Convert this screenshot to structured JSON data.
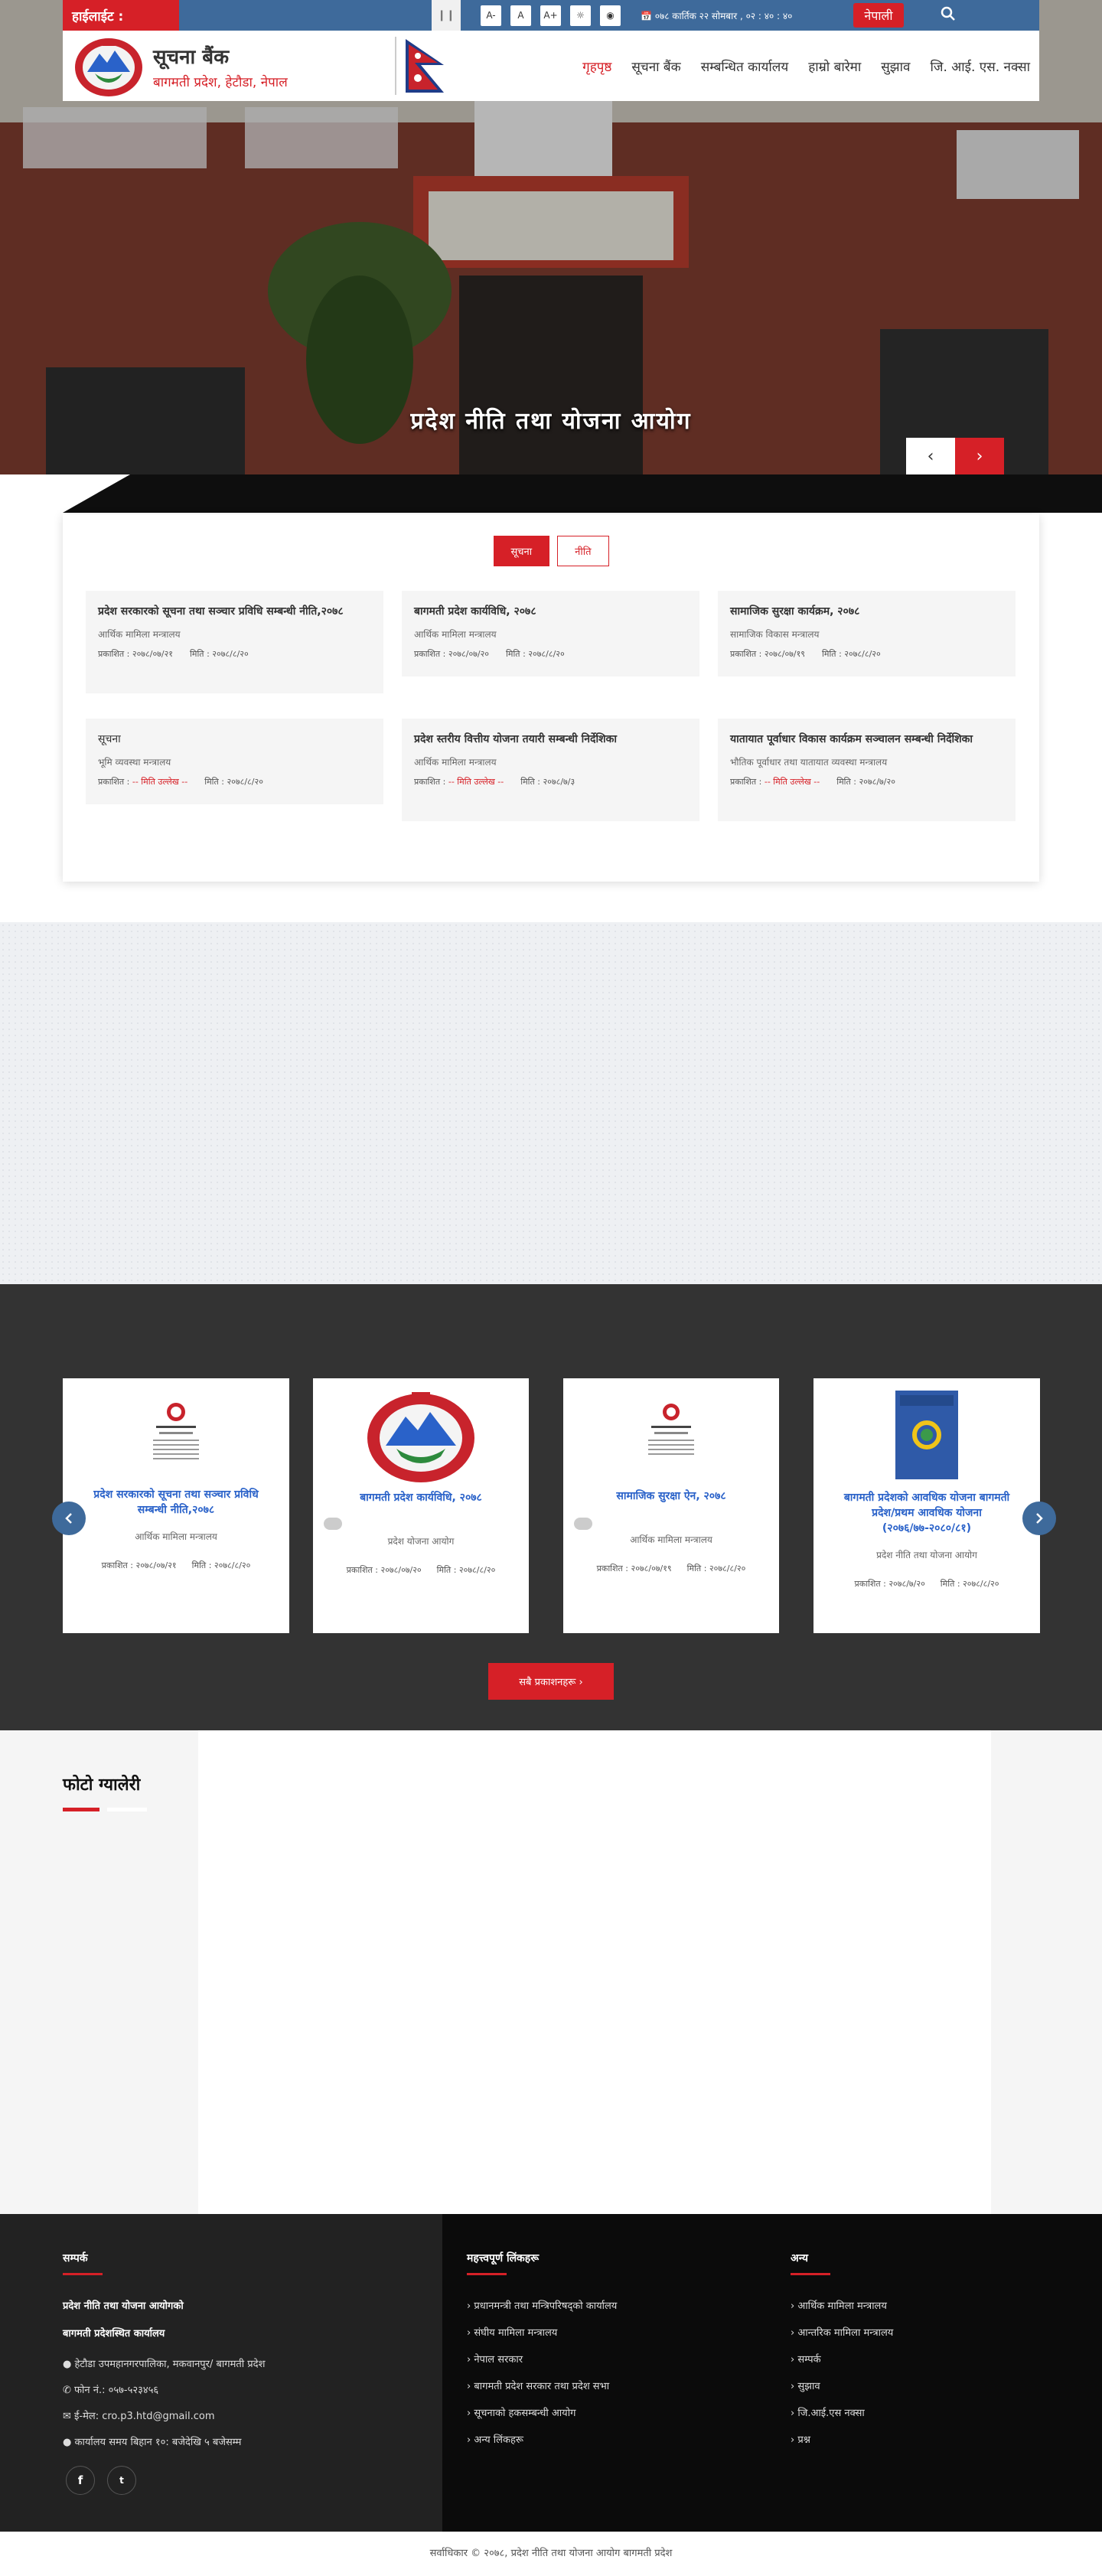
{
  "topbar": {
    "highlight_label": "हाईलाईट :",
    "toggle": "❙❙",
    "a11y": [
      "A-",
      "A",
      "A+",
      "☼",
      "◉"
    ],
    "date": "📅 ०७८ कार्तिक २२ सोमबार , ०२ : ४० : ४०",
    "language": "नेपाली",
    "search_icon": "search-icon"
  },
  "header": {
    "title": "सूचना बैंक",
    "subtitle": "बागमती प्रदेश, हेटौडा, नेपाल",
    "nav": [
      "गृहपृष्ठ",
      "सूचना बैंक",
      "सम्बन्धित कार्यालय",
      "हाम्रो बारेमा",
      "सुझाव",
      "जि. आई. एस. नक्सा"
    ]
  },
  "hero": {
    "caption": "प्रदेश नीति तथा योजना आयोग",
    "prev": "‹",
    "next": "›"
  },
  "notices": {
    "tabs": [
      "सूचना",
      "नीति"
    ],
    "cards": [
      {
        "title": "प्रदेश सरकारको सूचना तथा सञ्चार प्रविधि सम्बन्धी नीति,२०७८",
        "office": "आर्थिक मामिला मन्त्रालय",
        "from": "प्रकाशित : २०७८/०७/२१",
        "to": "मिति : २०७८/८/२०"
      },
      {
        "title": "बागमती प्रदेश कार्यविधि, २०७८",
        "office": "आर्थिक मामिला मन्त्रालय",
        "from": "प्रकाशित : २०७८/०७/२०",
        "to": "मिति : २०७८/८/२०"
      },
      {
        "title": "सामाजिक सुरक्षा कार्यक्रम, २०७८",
        "office": "सामाजिक विकास मन्त्रालय",
        "from": "प्रकाशित : २०७८/०७/१९",
        "to": "मिति : २०७८/८/२०"
      },
      {
        "title": "सूचना",
        "office": "भूमि व्यवस्था मन्त्रालय",
        "from_label": "प्रकाशित : ",
        "from_red": "-- मिति उल्लेख --",
        "to": "मिति : २०७८/८/२०"
      },
      {
        "title": "प्रदेश स्तरीय वित्तीय योजना तयारी सम्बन्धी निर्देशिका",
        "office": "आर्थिक मामिला मन्त्रालय",
        "from_label": "प्रकाशित : ",
        "from_red": "-- मिति उल्लेख --",
        "to": "मिति : २०७८/७/३"
      },
      {
        "title": "यातायात पूर्वाधार विकास कार्यक्रम सञ्चालन सम्बन्धी निर्देशिका",
        "office": "भौतिक पूर्वाधार तथा यातायात व्यवस्था मन्त्रालय",
        "from_label": "प्रकाशित : ",
        "from_red": "-- मिति उल्लेख --",
        "to": "मिति : २०७८/७/२०"
      }
    ]
  },
  "publications": {
    "items": [
      {
        "name": "प्रदेश सरकारको सूचना तथा सञ्चार प्रविधि सम्बन्धी नीति,२०७८",
        "office": "आर्थिक मामिला मन्त्रालय",
        "from": "प्रकाशित : २०७८/०७/२१",
        "to": "मिति : २०७८/८/२०"
      },
      {
        "name": "बागमती प्रदेश कार्यविधि, २०७८",
        "office": "प्रदेश योजना आयोग",
        "from": "प्रकाशित : २०७८/०७/२०",
        "to": "मिति : २०७८/८/२०"
      },
      {
        "name": "सामाजिक सुरक्षा ऐन, २०७८",
        "office": "आर्थिक मामिला मन्त्रालय",
        "from": "प्रकाशित : २०७८/०७/१९",
        "to": "मिति : २०७८/८/२०"
      },
      {
        "name": "बागमती प्रदेशको आवधिक योजना बागमती प्रदेश/प्रथम आवधिक योजना (२०७६/७७-२०८०/८१)",
        "office": "प्रदेश नीति तथा योजना आयोग",
        "from": "प्रकाशित : २०७८/७/२०",
        "to": "मिति : २०७८/८/२०"
      }
    ],
    "more": "सबै प्रकाशनहरू  ›"
  },
  "gallery": {
    "title": "फोटो ग्यालेरी"
  },
  "footer": {
    "about_title": "सम्पर्क",
    "org1": "प्रदेश नीति तथा योजना आयोगको",
    "org2": "बागमती प्रदेशस्थित कार्यालय",
    "address": "हेटौडा उपमहानगरपालिका, मकवानपुर/ बागमती प्रदेश",
    "phone": "फोन नं.: ०५७-५२३४५६",
    "email": "ई-मेल: cro.p3.htd@gmail.com",
    "location": "कार्यालय समय बिहान १०: बजेदेखि ५ बजेसम्म",
    "links_title": "महत्त्वपूर्ण लिंकहरू",
    "links": [
      "प्रधानमन्त्री तथा मन्त्रिपरिषद्को कार्यालय",
      "संघीय मामिला मन्त्रालय",
      "नेपाल सरकार",
      "बागमती प्रदेश सरकार तथा प्रदेश सभा",
      "सूचनाको हकसम्बन्धी आयोग",
      "अन्य लिंकहरू"
    ],
    "other_title": "अन्य",
    "other": [
      "आर्थिक मामिला मन्त्रालय",
      "आन्तरिक मामिला मन्त्रालय",
      "सम्पर्क",
      "सुझाव",
      "जि.आई.एस नक्सा",
      "प्रश्न"
    ],
    "copyright": "सर्वाधिकार © २०७८, प्रदेश नीति तथा योजना आयोग बागमती प्रदेश"
  }
}
